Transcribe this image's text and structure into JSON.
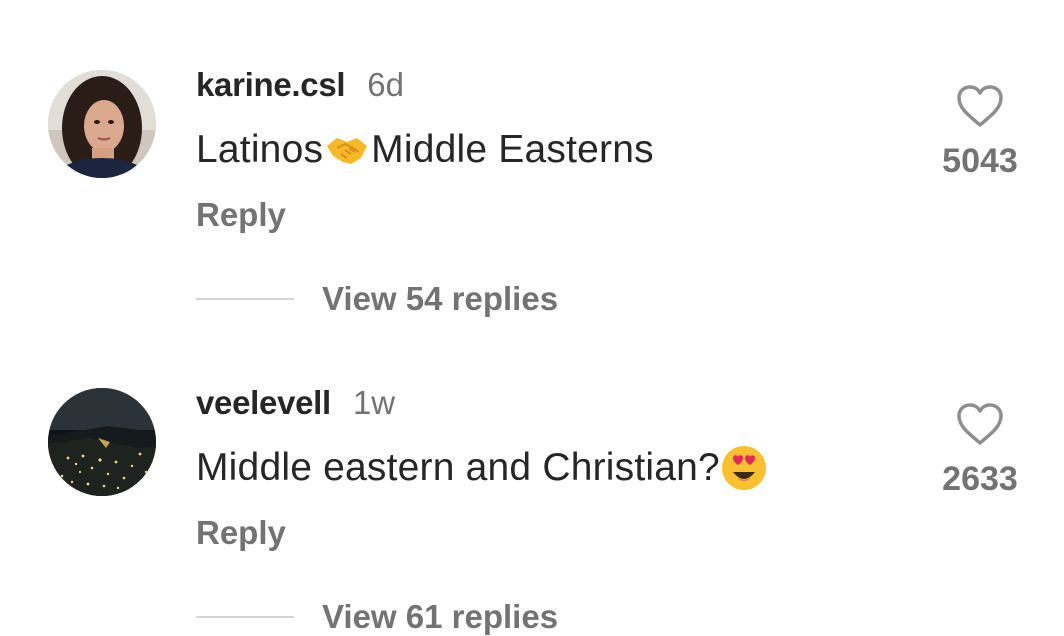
{
  "comments": [
    {
      "username": "karine.csl",
      "time": "6d",
      "text_before": "Latinos",
      "emoji": "handshake-emoji",
      "text_after": "Middle Easterns",
      "reply_label": "Reply",
      "like_count": "5043",
      "view_replies": "View 54 replies"
    },
    {
      "username": "veelevell",
      "time": "1w",
      "text_before": "Middle eastern and Christian?",
      "emoji": "heart-eyes-emoji",
      "text_after": "",
      "reply_label": "Reply",
      "like_count": "2633",
      "view_replies": "View 61 replies"
    }
  ],
  "colors": {
    "primary_text": "#262626",
    "secondary_text": "#737373",
    "divider": "#d4d4d4"
  }
}
